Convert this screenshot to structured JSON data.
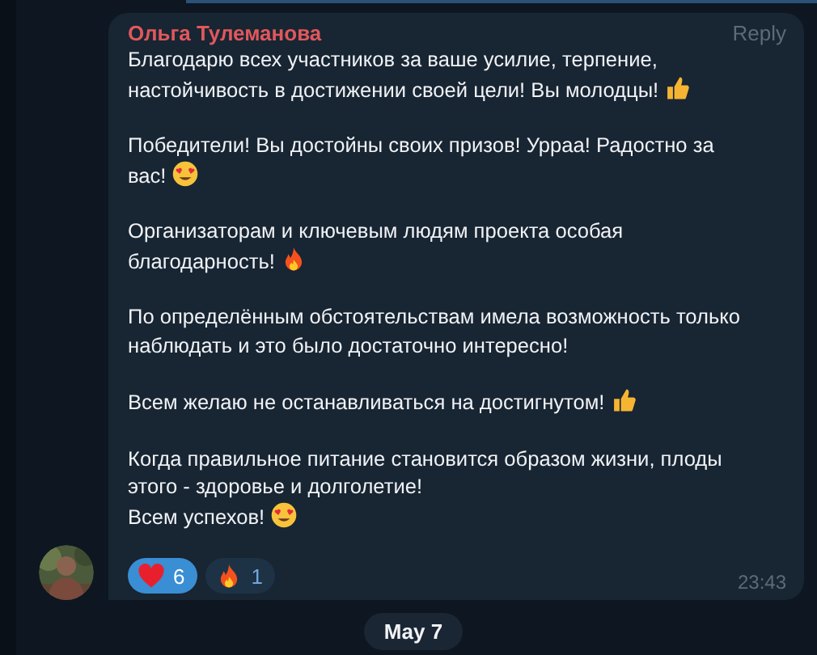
{
  "message": {
    "author": "Ольга Тулеманова",
    "reply": "Reply",
    "paragraphs": [
      {
        "lines": [
          {
            "text": "Благодарю всех участников за ваше усилие, терпение, настойчивость в достижении своей цели! Вы молодцы!",
            "emoji": {
              "kind": "thumbs-up"
            }
          }
        ]
      },
      {
        "lines": [
          {
            "text": "Победители! Вы достойны своих призов! Урраа! Радостно за вас!",
            "emoji": {
              "kind": "heart-eyes"
            }
          }
        ]
      },
      {
        "lines": [
          {
            "text": "Организаторам и ключевым людям проекта особая благодарность!",
            "emoji": {
              "kind": "fire"
            }
          }
        ]
      },
      {
        "lines": [
          {
            "text": "По определённым обстоятельствам имела возможность только наблюдать и это было достаточно интересно!"
          }
        ]
      },
      {
        "lines": [
          {
            "text": "Всем желаю не останавливаться на достигнутом!",
            "emoji": {
              "kind": "thumbs-up"
            }
          }
        ]
      },
      {
        "lines": [
          {
            "text": "Когда правильное питание становится образом жизни, плоды этого -  здоровье и долголетие!"
          },
          {
            "text": "Всем успехов!",
            "emoji": {
              "kind": "heart-eyes"
            }
          }
        ]
      }
    ],
    "reactions": [
      {
        "kind": "heart",
        "count": "6",
        "selected": true
      },
      {
        "kind": "fire",
        "count": "1",
        "selected": false
      }
    ],
    "time": "23:43"
  },
  "date_separator": "May 7"
}
